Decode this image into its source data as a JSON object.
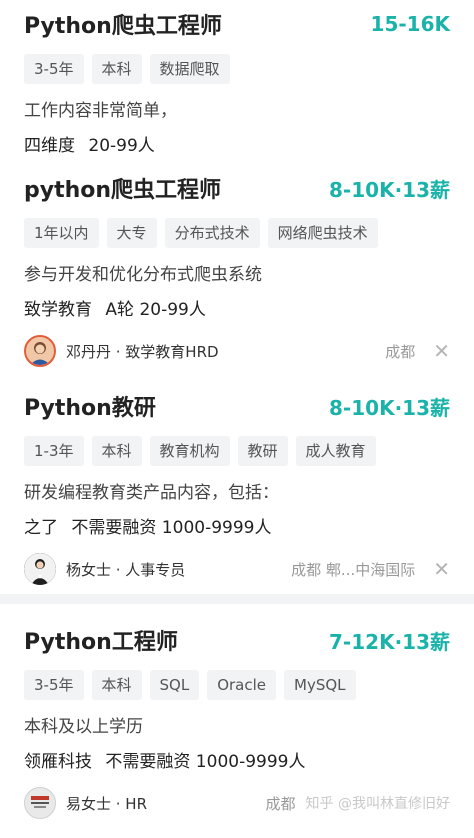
{
  "accent_color": "#1bb3a9",
  "jobs": [
    {
      "title": "Python爬虫工程师",
      "salary": "15-16K",
      "tags": [
        "3-5年",
        "本科",
        "数据爬取"
      ],
      "description": "工作内容非常简单，",
      "company": "四维度",
      "company_info": "20-99人"
    },
    {
      "title": "python爬虫工程师",
      "salary": "8-10K·13薪",
      "tags": [
        "1年以内",
        "大专",
        "分布式技术",
        "网络爬虫技术"
      ],
      "description": "参与开发和优化分布式爬虫系统",
      "company": "致学教育",
      "company_info": "A轮  20-99人",
      "recruiter": {
        "name": "邓丹丹 · 致学教育HRD",
        "location": "成都",
        "avatar_icon": "person-avatar-icon"
      }
    },
    {
      "title": "Python教研",
      "salary": "8-10K·13薪",
      "tags": [
        "1-3年",
        "本科",
        "教育机构",
        "教研",
        "成人教育"
      ],
      "description": "研发编程教育类产品内容，包括：",
      "company": "之了",
      "company_info": "不需要融资  1000-9999人",
      "recruiter": {
        "name": "杨女士 · 人事专员",
        "location": "成都  郫...中海国际",
        "avatar_icon": "person-avatar-icon"
      }
    },
    {
      "title": "Python工程师",
      "salary": "7-12K·13薪",
      "tags": [
        "3-5年",
        "本科",
        "SQL",
        "Oracle",
        "MySQL"
      ],
      "description": "本科及以上学历",
      "company": "领雁科技",
      "company_info": "不需要融资  1000-9999人",
      "recruiter": {
        "name": "易女士 · HR",
        "location": "成都",
        "watermark": "知乎 @我叫林直修旧好",
        "avatar_icon": "company-logo-icon"
      }
    }
  ]
}
